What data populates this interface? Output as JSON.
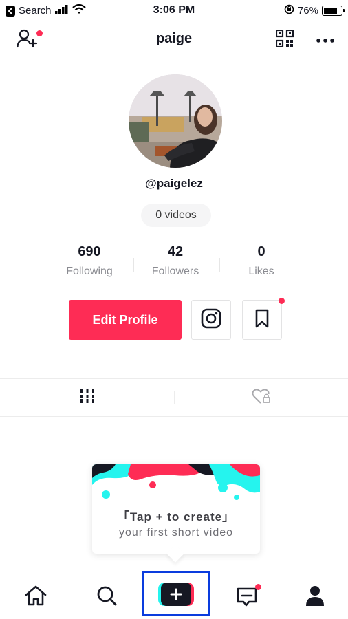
{
  "status_bar": {
    "back_app": "Search",
    "time": "3:06 PM",
    "battery_percent": "76%",
    "battery_level": 0.76
  },
  "header": {
    "title": "paige",
    "add_friend_has_notification": true
  },
  "profile": {
    "handle": "@paigelez",
    "videos_label": "0 videos",
    "stats": [
      {
        "value": "690",
        "label": "Following"
      },
      {
        "value": "42",
        "label": "Followers"
      },
      {
        "value": "0",
        "label": "Likes"
      }
    ],
    "edit_profile_label": "Edit Profile"
  },
  "tooltip": {
    "line1": "「Tap + to create」",
    "line2": "your first short video"
  },
  "colors": {
    "brand_red": "#fe2c55",
    "brand_cyan": "#25f4ee",
    "highlight_blue": "#0a3cde"
  },
  "icons": {
    "header": [
      "add-user-icon",
      "qr-code-icon",
      "more-icon"
    ],
    "actions": [
      "instagram-icon",
      "bookmark-icon"
    ],
    "tabs": [
      "grid-icon",
      "liked-icon"
    ],
    "nav": [
      "home-icon",
      "search-icon",
      "plus-icon",
      "inbox-icon",
      "profile-icon"
    ]
  }
}
